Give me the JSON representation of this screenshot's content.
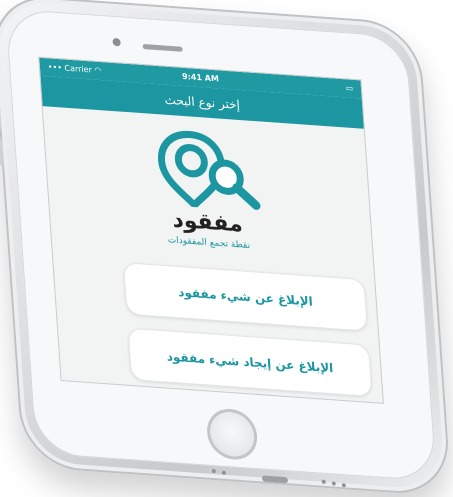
{
  "status_bar": {
    "carrier": "Carrier",
    "time": "9:41 AM",
    "battery": "",
    "wifi_icon": "wifi-icon",
    "signal_icon": "signal-dots-icon",
    "battery_icon": "battery-icon"
  },
  "nav": {
    "title": "إختر نوع البحث"
  },
  "brand": {
    "app_name": "مفقود",
    "tagline": "نقطة تجمع المفقودات",
    "logo_icon": "magnifier-pin-logo-icon",
    "accent": "#1c96a0"
  },
  "options": [
    {
      "label": "الإبلاغ عن شيء مفقود"
    },
    {
      "label": "الإبلاغ عن إيجاد شيء مفقود"
    }
  ]
}
